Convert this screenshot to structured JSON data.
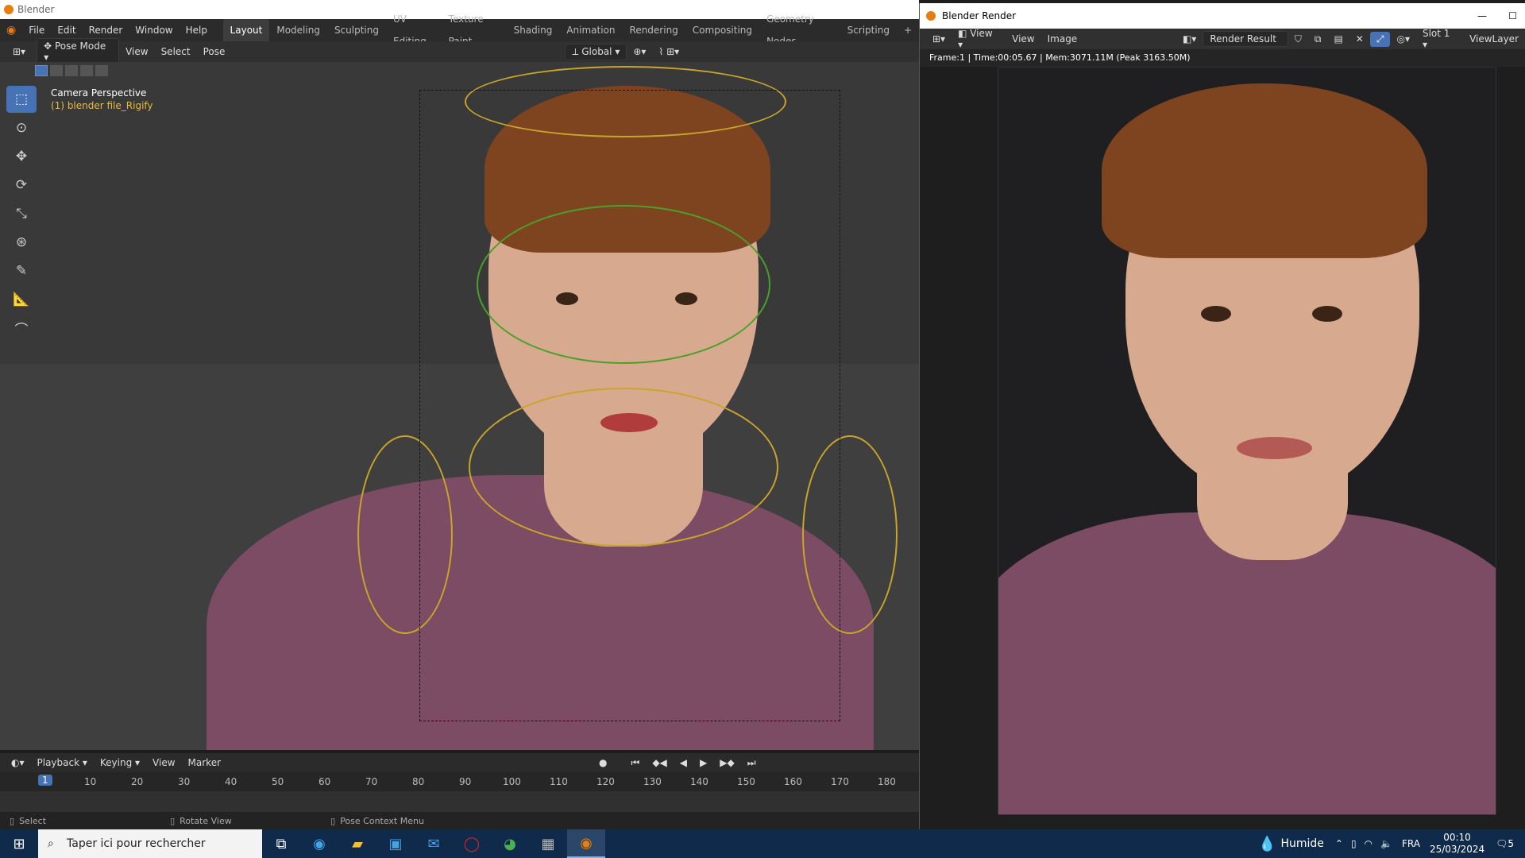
{
  "app": {
    "title": "Blender"
  },
  "menu": [
    "File",
    "Edit",
    "Render",
    "Window",
    "Help"
  ],
  "workspaces": [
    {
      "label": "Layout",
      "active": true
    },
    {
      "label": "Modeling"
    },
    {
      "label": "Sculpting"
    },
    {
      "label": "UV Editing"
    },
    {
      "label": "Texture Paint"
    },
    {
      "label": "Shading"
    },
    {
      "label": "Animation"
    },
    {
      "label": "Rendering"
    },
    {
      "label": "Compositing"
    },
    {
      "label": "Geometry Nodes"
    },
    {
      "label": "Scripting"
    }
  ],
  "header": {
    "mode": "Pose Mode",
    "view": "View",
    "select": "Select",
    "pose": "Pose",
    "orientation": "Global"
  },
  "viewport": {
    "camera_label": "Camera Perspective",
    "object_label": "(1) blender file_Rigify"
  },
  "timeline": {
    "menus": [
      "Playback",
      "Keying",
      "View",
      "Marker"
    ],
    "current_frame": "1",
    "ticks": [
      "10",
      "20",
      "30",
      "40",
      "50",
      "60",
      "70",
      "80",
      "90",
      "100",
      "110",
      "120",
      "130",
      "140",
      "150",
      "160",
      "170",
      "180"
    ]
  },
  "status": {
    "select": "Select",
    "rotate": "Rotate View",
    "context": "Pose Context Menu"
  },
  "render": {
    "window_title": "Blender Render",
    "view": "View",
    "view2": "View",
    "image": "Image",
    "result": "Render Result",
    "slot": "Slot 1",
    "layer": "ViewLayer",
    "info": "Frame:1 | Time:00:05.67 | Mem:3071.11M (Peak 3163.50M)"
  },
  "taskbar": {
    "search_placeholder": "Taper ici pour rechercher",
    "weather": "Humide",
    "lang": "FRA",
    "time": "00:10",
    "date": "25/03/2024",
    "notif": "5"
  },
  "colors": {
    "accent": "#4772b3",
    "blender_orange": "#e87d0d",
    "shirt": "#7b4c63",
    "hair": "#7e4420",
    "skin": "#d7aa90"
  }
}
